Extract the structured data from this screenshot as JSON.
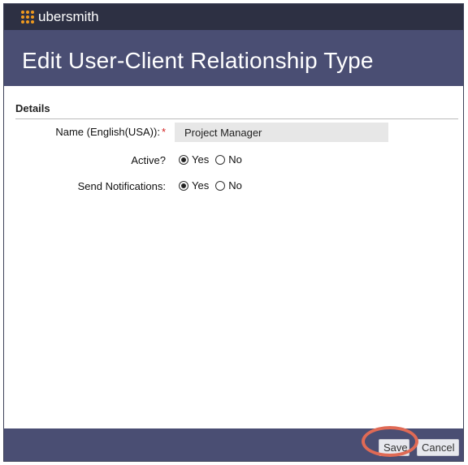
{
  "brand": {
    "name": "ubersmith",
    "logo_color": "#f09a1e"
  },
  "page_title": "Edit User-Client Relationship Type",
  "section": {
    "title": "Details"
  },
  "fields": {
    "name": {
      "label": "Name (English(USA)):",
      "required_mark": "*",
      "value": "Project Manager"
    },
    "active": {
      "label": "Active?",
      "options": [
        "Yes",
        "No"
      ],
      "selected": "Yes"
    },
    "notifications": {
      "label": "Send Notifications:",
      "options": [
        "Yes",
        "No"
      ],
      "selected": "Yes"
    }
  },
  "footer": {
    "save_label": "Save",
    "cancel_label": "Cancel"
  },
  "colors": {
    "topbar": "#2d3043",
    "header": "#4a4e73",
    "highlight_ring": "#e06a55"
  }
}
